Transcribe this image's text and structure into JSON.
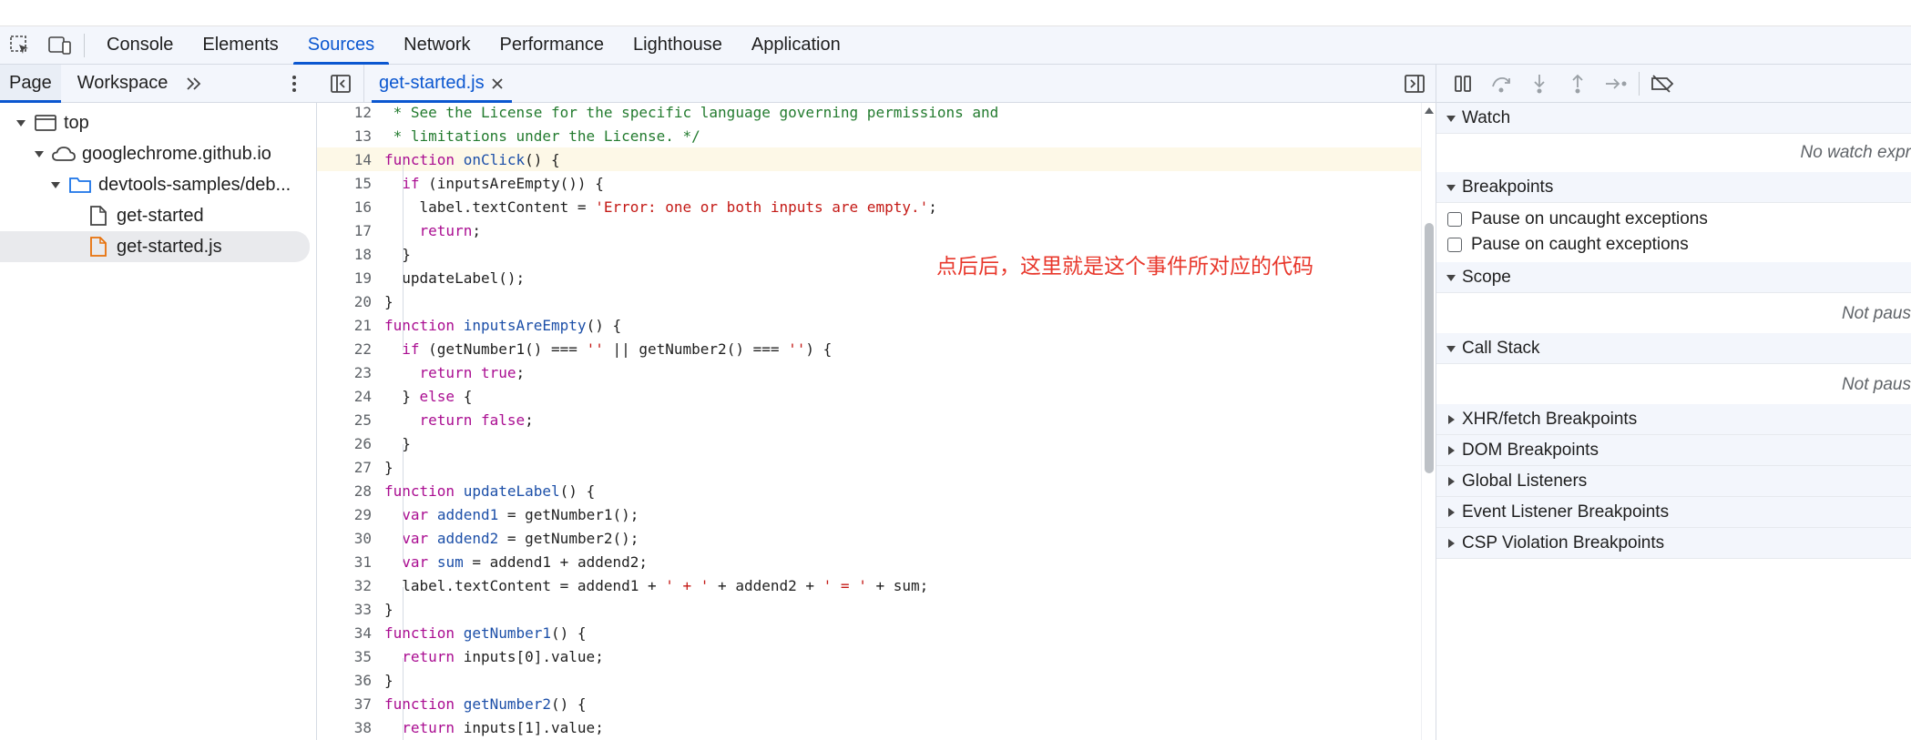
{
  "tabs": [
    "Console",
    "Elements",
    "Sources",
    "Network",
    "Performance",
    "Lighthouse",
    "Application"
  ],
  "active_tab": "Sources",
  "navigator": {
    "tabs": [
      "Page",
      "Workspace"
    ],
    "tree": [
      {
        "label": "top",
        "icon": "frame-icon",
        "expanded": true
      },
      {
        "label": "googlechrome.github.io",
        "icon": "cloud-icon",
        "expanded": true
      },
      {
        "label": "devtools-samples/deb...",
        "icon": "folder-icon",
        "expanded": true
      },
      {
        "label": "get-started",
        "icon": "document-icon"
      },
      {
        "label": "get-started.js",
        "icon": "js-file-icon",
        "selected": true
      }
    ]
  },
  "editor": {
    "file_tab": "get-started.js",
    "annotation": "点后后，这里就是这个事件所对应的代码",
    "lines": [
      {
        "n": "12",
        "text": " * See the License for the specific language governing permissions and"
      },
      {
        "n": "13",
        "text": " * limitations under the License. */"
      },
      {
        "n": "14",
        "text": "function onClick() {"
      },
      {
        "n": "15",
        "text": "  if (inputsAreEmpty()) {"
      },
      {
        "n": "16",
        "text": "    label.textContent = 'Error: one or both inputs are empty.';"
      },
      {
        "n": "17",
        "text": "    return;"
      },
      {
        "n": "18",
        "text": "  }"
      },
      {
        "n": "19",
        "text": "  updateLabel();"
      },
      {
        "n": "20",
        "text": "}"
      },
      {
        "n": "21",
        "text": "function inputsAreEmpty() {"
      },
      {
        "n": "22",
        "text": "  if (getNumber1() === '' || getNumber2() === '') {"
      },
      {
        "n": "23",
        "text": "    return true;"
      },
      {
        "n": "24",
        "text": "  } else {"
      },
      {
        "n": "25",
        "text": "    return false;"
      },
      {
        "n": "26",
        "text": "  }"
      },
      {
        "n": "27",
        "text": "}"
      },
      {
        "n": "28",
        "text": "function updateLabel() {"
      },
      {
        "n": "29",
        "text": "  var addend1 = getNumber1();"
      },
      {
        "n": "30",
        "text": "  var addend2 = getNumber2();"
      },
      {
        "n": "31",
        "text": "  var sum = addend1 + addend2;"
      },
      {
        "n": "32",
        "text": "  label.textContent = addend1 + ' + ' + addend2 + ' = ' + sum;"
      },
      {
        "n": "33",
        "text": "}"
      },
      {
        "n": "34",
        "text": "function getNumber1() {"
      },
      {
        "n": "35",
        "text": "  return inputs[0].value;"
      },
      {
        "n": "36",
        "text": "}"
      },
      {
        "n": "37",
        "text": "function getNumber2() {"
      },
      {
        "n": "38",
        "text": "  return inputs[1].value;"
      }
    ]
  },
  "debugger": {
    "sections": {
      "watch": "Watch",
      "watch_empty": "No watch expr",
      "breakpoints": "Breakpoints",
      "pause_uncaught": "Pause on uncaught exceptions",
      "pause_caught": "Pause on caught exceptions",
      "scope": "Scope",
      "scope_empty": "Not paus",
      "call_stack": "Call Stack",
      "call_stack_empty": "Not paus",
      "xhr": "XHR/fetch Breakpoints",
      "dom": "DOM Breakpoints",
      "global": "Global Listeners",
      "event": "Event Listener Breakpoints",
      "csp": "CSP Violation Breakpoints"
    }
  },
  "colors": {
    "accent": "#0b57d0",
    "annotation": "#e8382c",
    "keyword": "#aa0d91",
    "string": "#c41a16",
    "comment": "#237b2f",
    "function": "#1c4fa8"
  }
}
